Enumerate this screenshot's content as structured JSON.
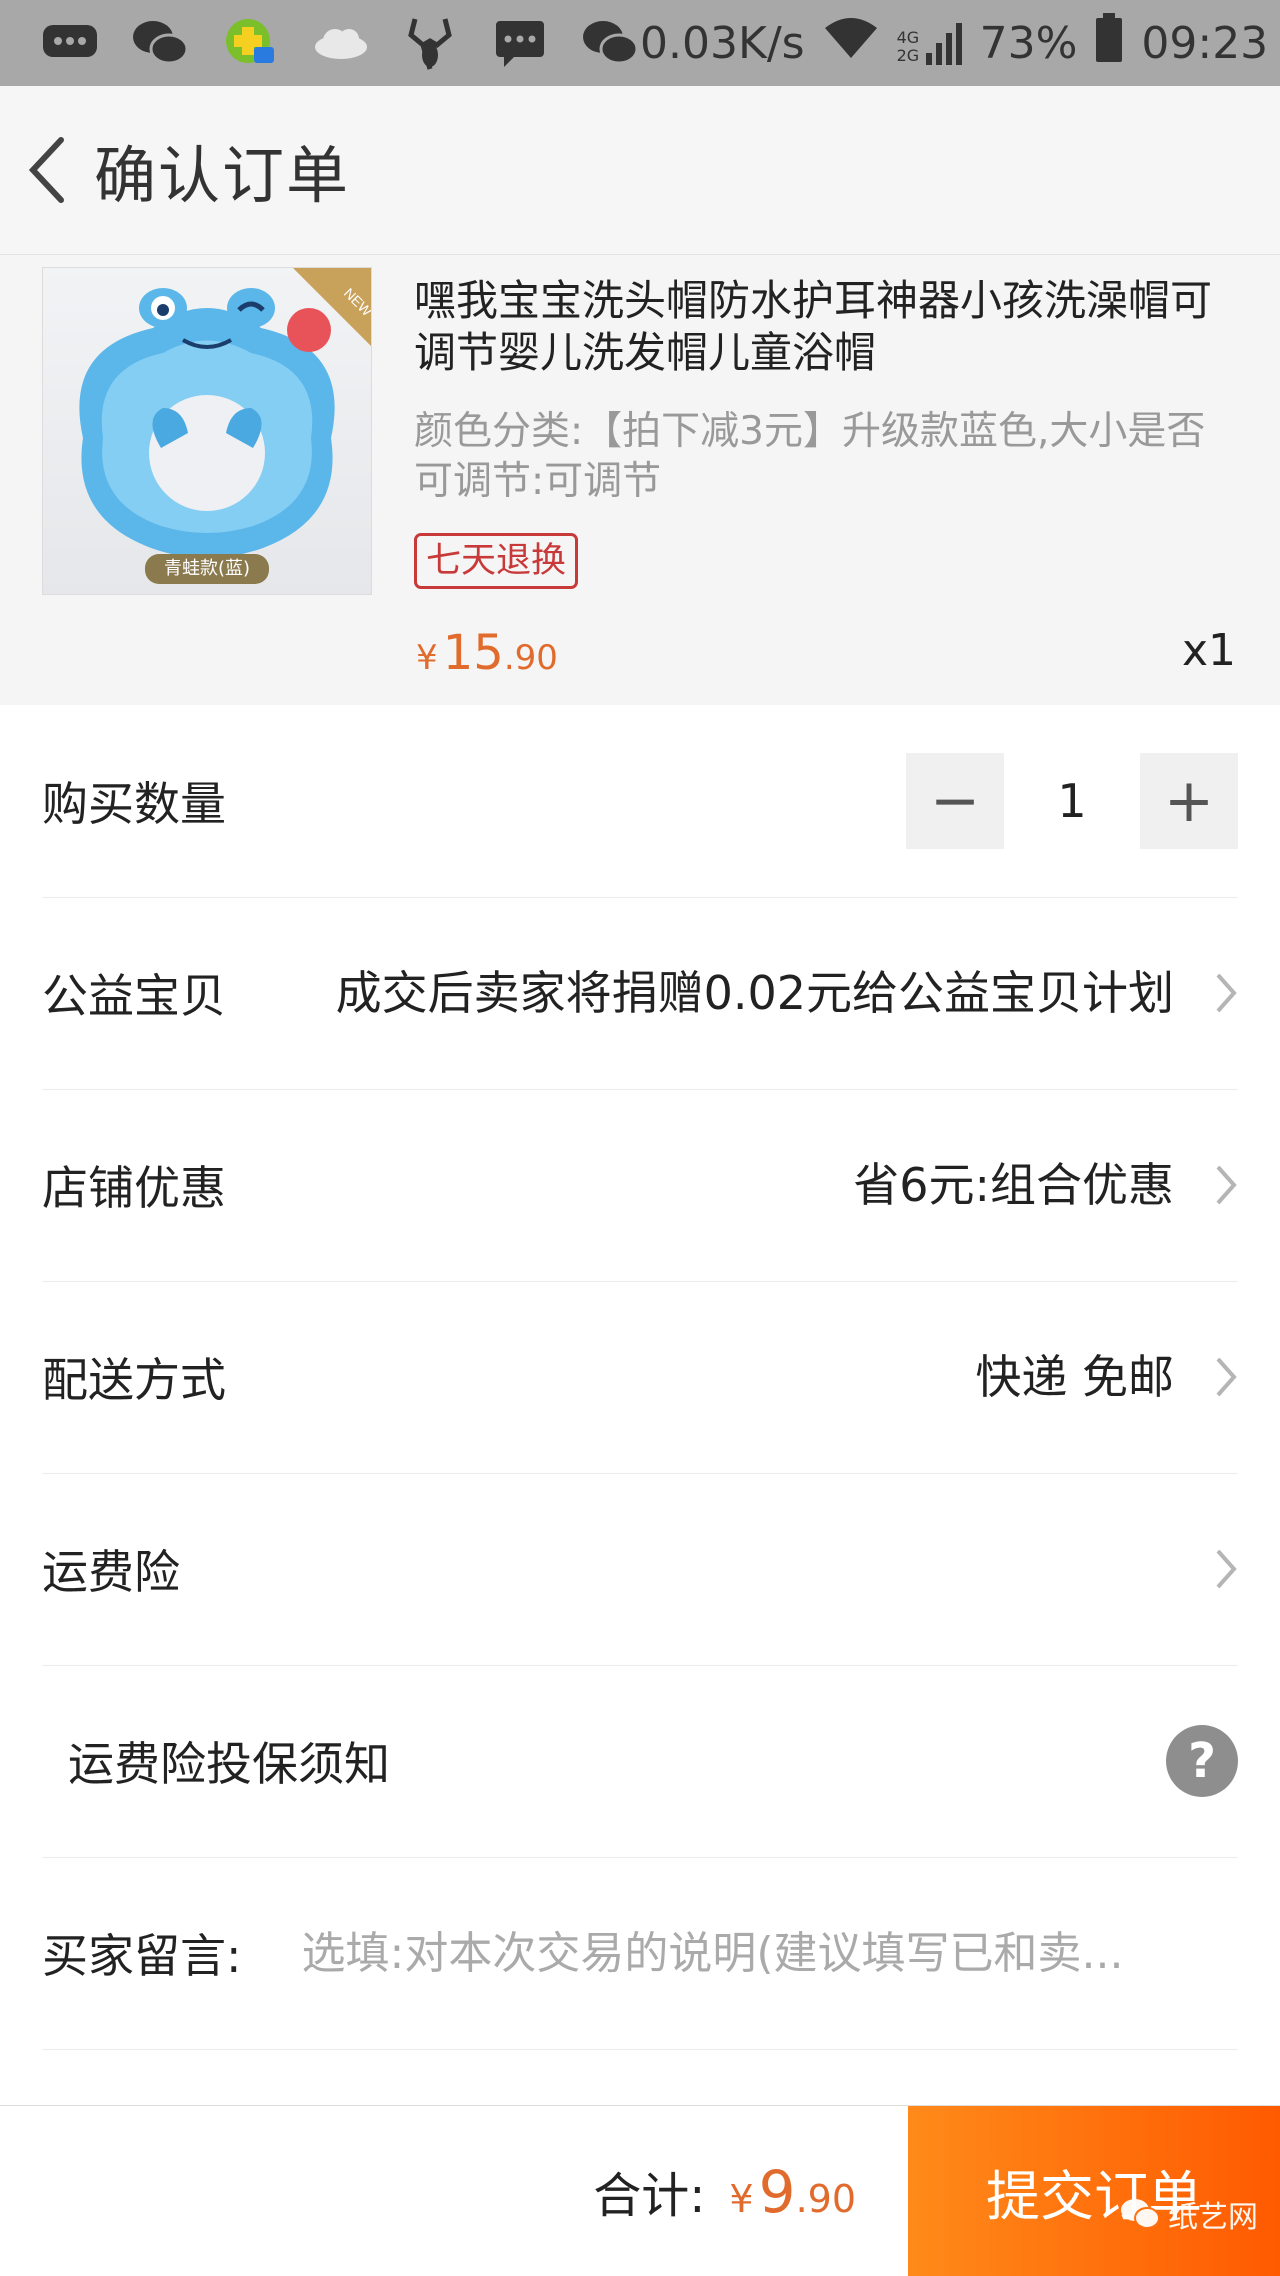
{
  "status_bar": {
    "net_speed": "0.03K/s",
    "network_type": "4G 2G",
    "battery": "73%",
    "time": "09:23",
    "icons": [
      "message-icon",
      "wechat-icon",
      "qq-mail-icon",
      "cloud-icon",
      "deer-icon",
      "sms-icon",
      "wechat-icon",
      "wifi-icon",
      "signal-icon",
      "battery-icon"
    ]
  },
  "header": {
    "title": "确认订单"
  },
  "product": {
    "image_badge": "NEW",
    "image_label": "青蛙款(蓝)",
    "title": "嘿我宝宝洗头帽防水护耳神器小孩洗澡帽可调节婴儿洗发帽儿童浴帽",
    "spec": "颜色分类:【拍下减3元】升级款蓝色,大小是否可调节:可调节",
    "return_badge": "七天退换",
    "price_symbol": "¥",
    "price_int": "15",
    "price_dec": ".90",
    "quantity": "x1"
  },
  "quantity_row": {
    "label": "购买数量",
    "value": "1",
    "minus": "−",
    "plus": "+"
  },
  "charity_row": {
    "label": "公益宝贝",
    "value": "成交后卖家将捐赠0.02元给公益宝贝计划"
  },
  "discount_row": {
    "label": "店铺优惠",
    "value": "省6元:组合优惠"
  },
  "delivery_row": {
    "label": "配送方式",
    "value": "快递 免邮"
  },
  "insurance_row": {
    "label": "运费险"
  },
  "insurance_notice_row": {
    "label": "运费险投保须知",
    "help": "?"
  },
  "message_row": {
    "label": "买家留言:",
    "placeholder": "选填:对本次交易的说明(建议填写已和卖..."
  },
  "footer": {
    "total_label": "合计:",
    "total_symbol": "¥",
    "total_int": "9",
    "total_dec": ".90",
    "submit_label": "提交订单",
    "watermark": "纸艺网"
  },
  "colors": {
    "accent": "#ff6a00",
    "price": "#e06b2c",
    "badge_red": "#c83a3a"
  }
}
